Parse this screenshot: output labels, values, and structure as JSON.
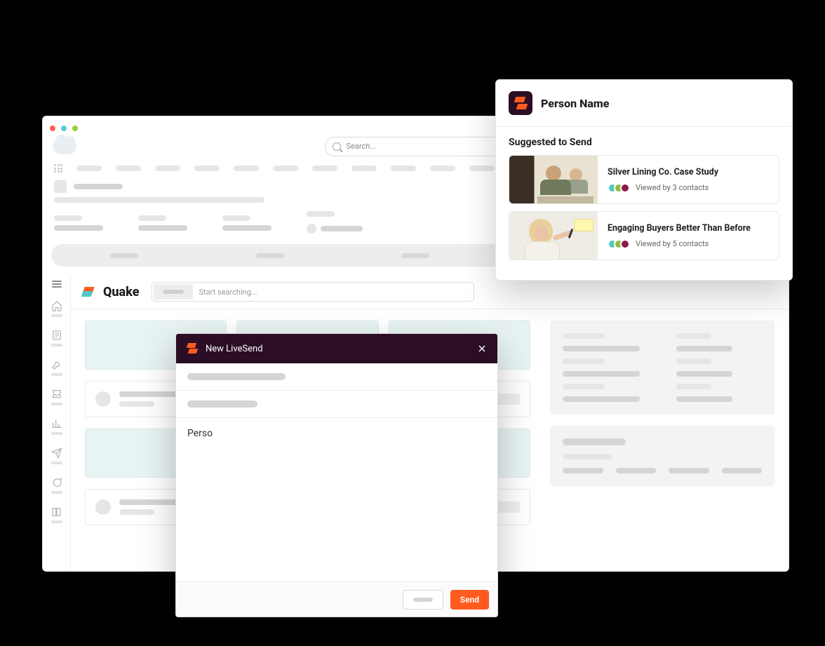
{
  "header": {
    "search_placeholder": "Search..."
  },
  "quake": {
    "brand": "Quake",
    "search_placeholder": "Start searching..."
  },
  "modal": {
    "title": "New LiveSend",
    "body_text": "Perso",
    "send_label": "Send"
  },
  "float": {
    "person_name": "Person Name",
    "section_title": "Suggested to Send",
    "items": [
      {
        "title": "Silver Lining Co. Case Study",
        "meta": "Viewed by 3 contacts"
      },
      {
        "title": "Engaging Buyers Better Than Before",
        "meta": "Viewed by 5 contacts"
      }
    ]
  }
}
